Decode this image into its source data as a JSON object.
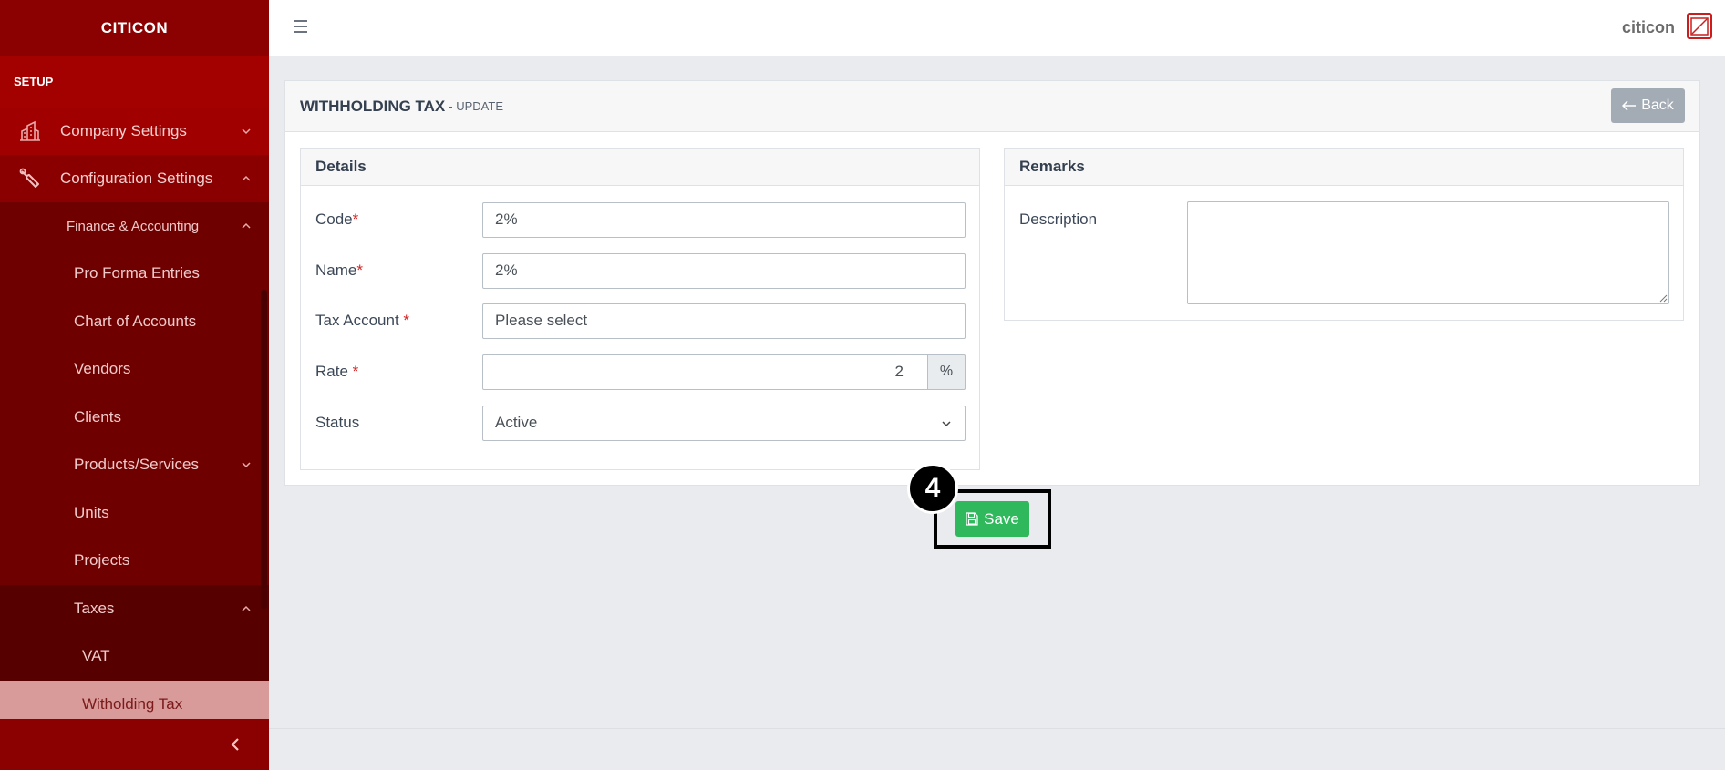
{
  "brand": "CITICON",
  "sidebar": {
    "section": "SETUP",
    "company_settings": "Company Settings",
    "configuration_settings": "Configuration Settings",
    "finance_accounting": "Finance & Accounting",
    "items": [
      {
        "label": "Pro Forma Entries"
      },
      {
        "label": "Chart of Accounts"
      },
      {
        "label": "Vendors"
      },
      {
        "label": "Clients"
      },
      {
        "label": "Products/Services"
      },
      {
        "label": "Units"
      },
      {
        "label": "Projects"
      },
      {
        "label": "Taxes"
      }
    ],
    "taxes_children": [
      {
        "label": "VAT"
      },
      {
        "label": "Witholding Tax",
        "active": true
      }
    ]
  },
  "topbar": {
    "username": "citicon"
  },
  "page": {
    "title": "WITHHOLDING TAX",
    "subtitle": "- UPDATE",
    "back_label": "Back"
  },
  "details": {
    "heading": "Details",
    "code_label": "Code",
    "code_value": "2%",
    "name_label": "Name",
    "name_value": "2%",
    "tax_account_label": "Tax Account",
    "tax_account_value": "Please select",
    "rate_label": "Rate",
    "rate_value": "2",
    "rate_unit": "%",
    "status_label": "Status",
    "status_value": "Active",
    "required_mark": "*"
  },
  "remarks": {
    "heading": "Remarks",
    "description_label": "Description",
    "description_value": ""
  },
  "actions": {
    "save_label": "Save",
    "step_number": "4"
  },
  "colors": {
    "sidebar_bg": "#7a0000",
    "active_item": "#d99a9a",
    "save_green": "#2fb85c",
    "back_gray": "#a3acb5"
  }
}
